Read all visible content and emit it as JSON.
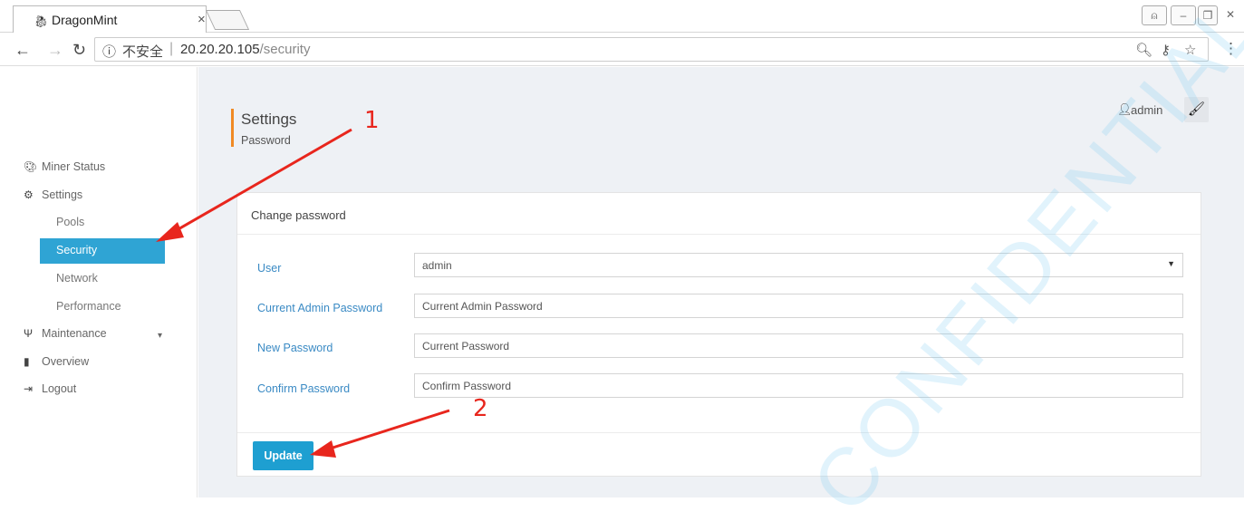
{
  "browser": {
    "tab_title": "DragonMint",
    "tab_close": "×",
    "security_label": "不安全",
    "url_host": "20.20.20.105",
    "url_path": "/security"
  },
  "sidebar": {
    "items": [
      {
        "label": "Miner Status",
        "icon": "dashboard-icon"
      },
      {
        "label": "Settings",
        "icon": "cogs-icon"
      },
      {
        "label": "Pools"
      },
      {
        "label": "Security",
        "active": true
      },
      {
        "label": "Network"
      },
      {
        "label": "Performance"
      },
      {
        "label": "Maintenance",
        "icon": "plug-icon"
      },
      {
        "label": "Overview",
        "icon": "book-icon"
      },
      {
        "label": "Logout",
        "icon": "sign-out-icon"
      }
    ]
  },
  "header": {
    "title": "Settings",
    "subtitle": "Password",
    "user": "admin"
  },
  "form": {
    "card_title": "Change password",
    "user_label": "User",
    "user_value": "admin",
    "current_label": "Current Admin Password",
    "current_placeholder": "Current Admin Password",
    "new_label": "New Password",
    "new_placeholder": "Current Password",
    "confirm_label": "Confirm Password",
    "confirm_placeholder": "Confirm Password",
    "submit_label": "Update"
  },
  "annotations": {
    "step1": "1",
    "step2": "2",
    "watermark": "CONFIDENTIAL"
  },
  "colors": {
    "accent": "#2fa4d4",
    "button": "#1e9fd1",
    "title_bar": "#f08a24",
    "annotation": "#e8261d"
  }
}
